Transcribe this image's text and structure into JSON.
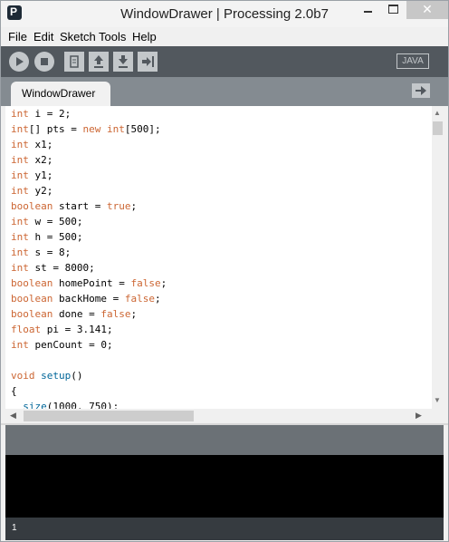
{
  "window": {
    "title": "WindowDrawer | Processing 2.0b7",
    "icon_letter": "P",
    "close_glyph": "✕"
  },
  "menu": {
    "items": [
      "File",
      "Edit",
      "Sketch",
      "Tools",
      "Help"
    ]
  },
  "toolbar": {
    "mode_label": "JAVA",
    "buttons": [
      "run-icon",
      "stop-icon",
      "new-icon",
      "open-icon",
      "save-icon",
      "export-icon"
    ]
  },
  "tabs": {
    "active_label": "WindowDrawer",
    "menu_icon": "arrow-right-icon"
  },
  "editor": {
    "lines": [
      [
        {
          "t": "int",
          "c": "kw"
        },
        {
          "t": " i = 2;"
        }
      ],
      [
        {
          "t": "int",
          "c": "kw"
        },
        {
          "t": "[] pts = "
        },
        {
          "t": "new",
          "c": "kw"
        },
        {
          "t": " "
        },
        {
          "t": "int",
          "c": "kw"
        },
        {
          "t": "[500];"
        }
      ],
      [
        {
          "t": "int",
          "c": "kw"
        },
        {
          "t": " x1;"
        }
      ],
      [
        {
          "t": "int",
          "c": "kw"
        },
        {
          "t": " x2;"
        }
      ],
      [
        {
          "t": "int",
          "c": "kw"
        },
        {
          "t": " y1;"
        }
      ],
      [
        {
          "t": "int",
          "c": "kw"
        },
        {
          "t": " y2;"
        }
      ],
      [
        {
          "t": "boolean",
          "c": "kw"
        },
        {
          "t": " start = "
        },
        {
          "t": "true",
          "c": "kw"
        },
        {
          "t": ";"
        }
      ],
      [
        {
          "t": "int",
          "c": "kw"
        },
        {
          "t": " w = 500;"
        }
      ],
      [
        {
          "t": "int",
          "c": "kw"
        },
        {
          "t": " h = 500;"
        }
      ],
      [
        {
          "t": "int",
          "c": "kw"
        },
        {
          "t": " s = 8;"
        }
      ],
      [
        {
          "t": "int",
          "c": "kw"
        },
        {
          "t": " st = 8000;"
        }
      ],
      [
        {
          "t": "boolean",
          "c": "kw"
        },
        {
          "t": " homePoint = "
        },
        {
          "t": "false",
          "c": "kw"
        },
        {
          "t": ";"
        }
      ],
      [
        {
          "t": "boolean",
          "c": "kw"
        },
        {
          "t": " backHome = "
        },
        {
          "t": "false",
          "c": "kw"
        },
        {
          "t": ";"
        }
      ],
      [
        {
          "t": "boolean",
          "c": "kw"
        },
        {
          "t": " done = "
        },
        {
          "t": "false",
          "c": "kw"
        },
        {
          "t": ";"
        }
      ],
      [
        {
          "t": "float",
          "c": "kw"
        },
        {
          "t": " pi = 3.141;"
        }
      ],
      [
        {
          "t": "int",
          "c": "kw"
        },
        {
          "t": " penCount = 0;"
        }
      ],
      [],
      [
        {
          "t": "void",
          "c": "kw"
        },
        {
          "t": " "
        },
        {
          "t": "setup",
          "c": "fn"
        },
        {
          "t": "()"
        }
      ],
      [
        {
          "t": "{"
        }
      ],
      [
        {
          "t": "  "
        },
        {
          "t": "size",
          "c": "fn"
        },
        {
          "t": "(1000, 750);"
        }
      ]
    ]
  },
  "scrollbars": {
    "up_glyph": "▲",
    "down_glyph": "▼",
    "left_glyph": "◀",
    "right_glyph": "▶"
  },
  "footer": {
    "line_number": "1"
  },
  "colors": {
    "keyword": "#cc6633",
    "function": "#006699",
    "toolbar": "#52585e",
    "tabbar": "#848b91"
  }
}
